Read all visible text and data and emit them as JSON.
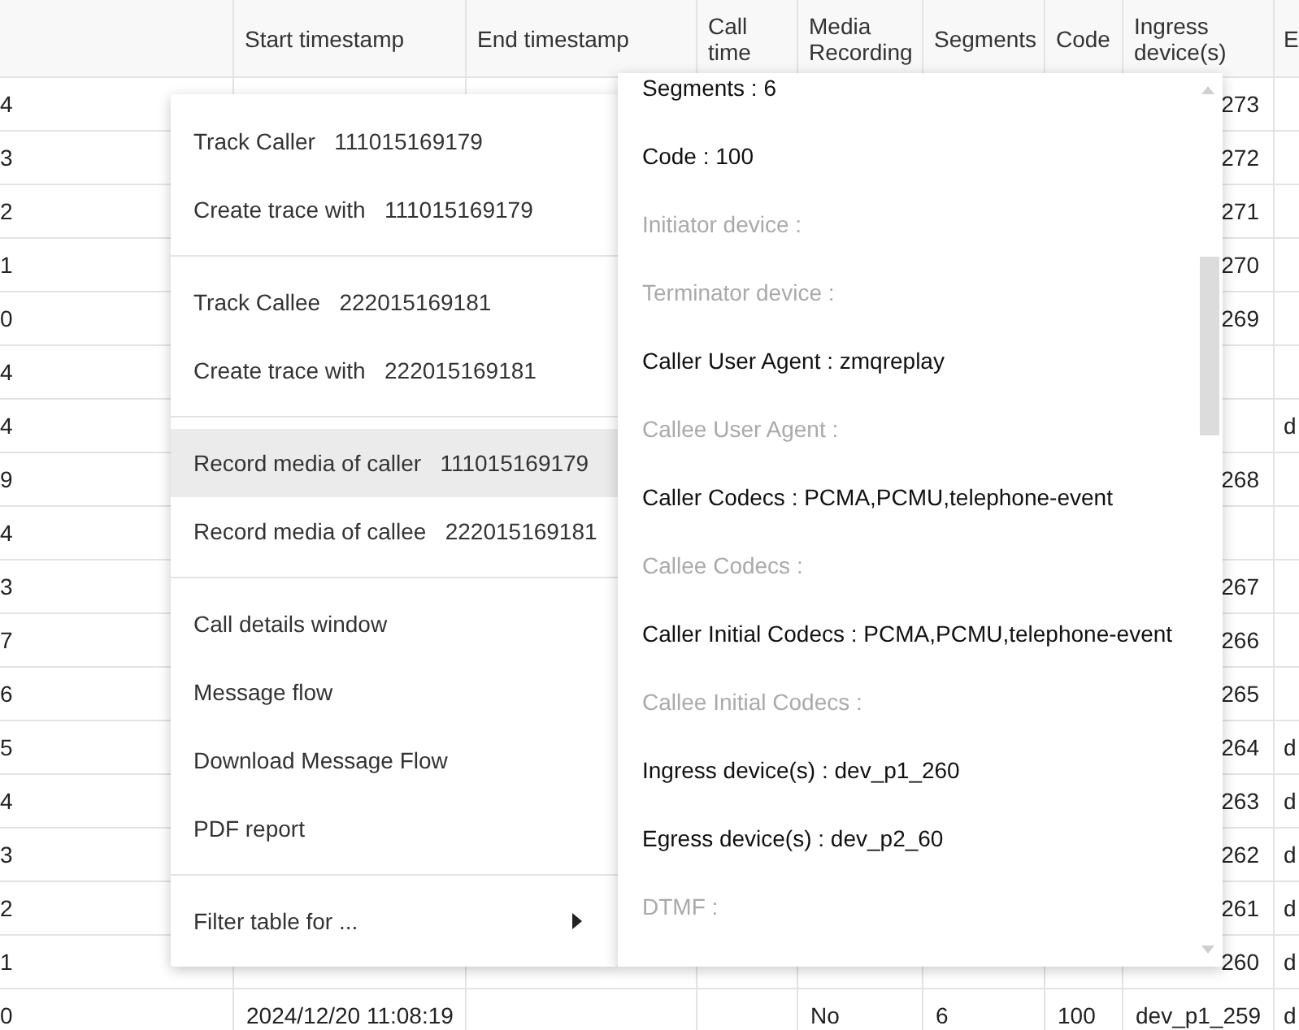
{
  "table": {
    "columns": [
      "",
      "Start timestamp",
      "End timestamp",
      "Call time",
      "Media Recording",
      "Segments",
      "Code",
      "Ingress device(s)",
      "E"
    ],
    "rows": [
      [
        "4",
        "",
        "",
        "",
        "",
        "",
        "",
        "273",
        ""
      ],
      [
        "3",
        "",
        "",
        "",
        "",
        "",
        "",
        "272",
        ""
      ],
      [
        "2",
        "",
        "",
        "",
        "",
        "",
        "",
        "271",
        ""
      ],
      [
        "1",
        "",
        "",
        "",
        "",
        "",
        "",
        "270",
        ""
      ],
      [
        "0",
        "",
        "",
        "",
        "",
        "",
        "",
        "269",
        ""
      ],
      [
        "4",
        "",
        "",
        "",
        "",
        "",
        "",
        "",
        ""
      ],
      [
        "4",
        "",
        "",
        "",
        "",
        "",
        "",
        "",
        "d"
      ],
      [
        "9",
        "",
        "",
        "",
        "",
        "",
        "",
        "268",
        ""
      ],
      [
        "4",
        "",
        "",
        "",
        "",
        "",
        "",
        "",
        ""
      ],
      [
        "3",
        "",
        "",
        "",
        "",
        "",
        "",
        "267",
        ""
      ],
      [
        "7",
        "",
        "",
        "",
        "",
        "",
        "",
        "266",
        ""
      ],
      [
        "6",
        "",
        "",
        "",
        "",
        "",
        "",
        "265",
        ""
      ],
      [
        "5",
        "",
        "",
        "",
        "",
        "",
        "",
        "264",
        "d"
      ],
      [
        "4",
        "",
        "",
        "",
        "",
        "",
        "",
        "263",
        "d"
      ],
      [
        "3",
        "",
        "",
        "",
        "",
        "",
        "",
        "262",
        "d"
      ],
      [
        "2",
        "",
        "",
        "",
        "",
        "",
        "",
        "261",
        "d"
      ],
      [
        "1",
        "",
        "",
        "",
        "",
        "",
        "",
        "260",
        "d"
      ],
      [
        "0",
        "2024/12/20 11:08:19",
        "",
        "",
        "No",
        "6",
        "100",
        "dev_p1_259",
        "d"
      ]
    ]
  },
  "context_menu": {
    "groups": [
      {
        "items": [
          {
            "kind": "action",
            "label": "Track Caller",
            "value": "111015169179",
            "selected": false
          },
          {
            "kind": "action",
            "label": "Create trace with",
            "value": "111015169179",
            "selected": false
          }
        ]
      },
      {
        "items": [
          {
            "kind": "action",
            "label": "Track Callee",
            "value": "222015169181",
            "selected": false
          },
          {
            "kind": "action",
            "label": "Create trace with",
            "value": "222015169181",
            "selected": false
          }
        ]
      },
      {
        "items": [
          {
            "kind": "action",
            "label": "Record media of caller",
            "value": "111015169179",
            "selected": true
          },
          {
            "kind": "action",
            "label": "Record media of callee",
            "value": "222015169181",
            "selected": false
          }
        ]
      },
      {
        "items": [
          {
            "kind": "action",
            "label": "Call details window",
            "selected": false
          },
          {
            "kind": "action",
            "label": "Message flow",
            "selected": false
          },
          {
            "kind": "action",
            "label": "Download Message Flow",
            "selected": false
          },
          {
            "kind": "action",
            "label": "PDF report",
            "selected": false
          }
        ]
      },
      {
        "items": [
          {
            "kind": "submenu",
            "label": "Filter table for ...",
            "selected": false
          }
        ]
      }
    ]
  },
  "details_popup": {
    "lines": [
      {
        "text": "Segments : 6",
        "empty": false
      },
      {
        "text": "Code : 100",
        "empty": false
      },
      {
        "text": "Initiator device :",
        "empty": true
      },
      {
        "text": "Terminator device :",
        "empty": true
      },
      {
        "text": "Caller User Agent : zmqreplay",
        "empty": false
      },
      {
        "text": "Callee User Agent :",
        "empty": true
      },
      {
        "text": "Caller Codecs : PCMA,PCMU,telephone-event",
        "empty": false
      },
      {
        "text": "Callee Codecs :",
        "empty": true
      },
      {
        "text": "Caller Initial Codecs : PCMA,PCMU,telephone-event",
        "empty": false
      },
      {
        "text": "Callee Initial Codecs :",
        "empty": true
      },
      {
        "text": "Ingress device(s) : dev_p1_260",
        "empty": false
      },
      {
        "text": "Egress device(s) : dev_p2_60",
        "empty": false
      },
      {
        "text": "DTMF :",
        "empty": true
      }
    ]
  }
}
